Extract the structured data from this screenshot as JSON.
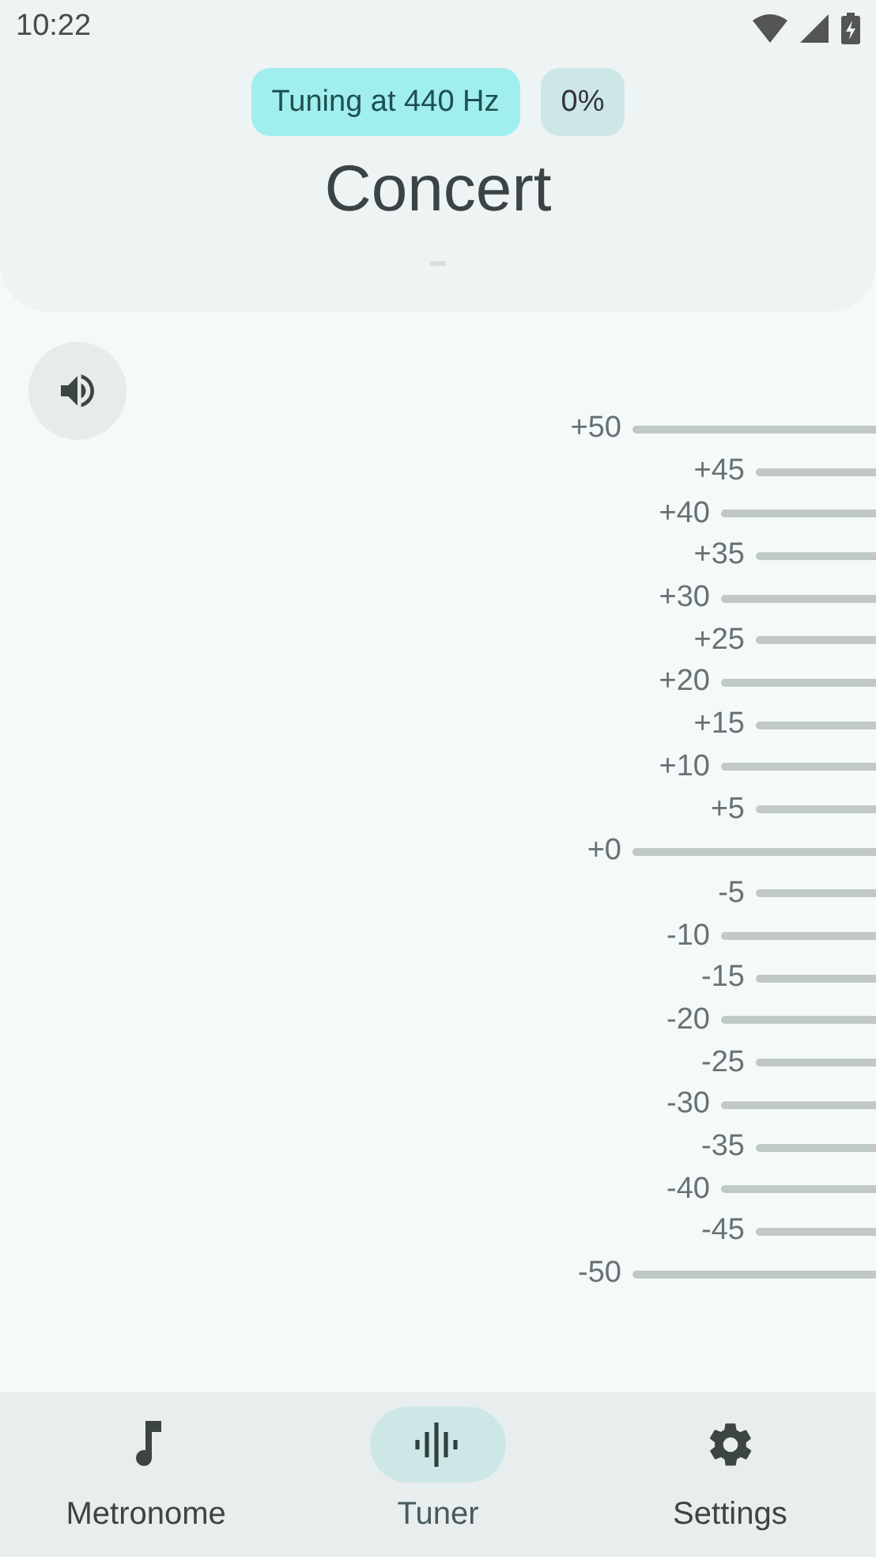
{
  "status_bar": {
    "time": "10:22"
  },
  "header": {
    "chips": [
      {
        "label": "Tuning at 440 Hz",
        "kind": "primary"
      },
      {
        "label": "0%",
        "kind": "secondary"
      }
    ],
    "title": "Concert"
  },
  "scale": {
    "ticks": [
      {
        "label": "+50",
        "kind": "major"
      },
      {
        "label": "+45",
        "kind": "minor"
      },
      {
        "label": "+40",
        "kind": "medium"
      },
      {
        "label": "+35",
        "kind": "minor"
      },
      {
        "label": "+30",
        "kind": "medium"
      },
      {
        "label": "+25",
        "kind": "minor"
      },
      {
        "label": "+20",
        "kind": "medium"
      },
      {
        "label": "+15",
        "kind": "minor"
      },
      {
        "label": "+10",
        "kind": "medium"
      },
      {
        "label": "+5",
        "kind": "minor"
      },
      {
        "label": "+0",
        "kind": "major"
      },
      {
        "label": "-5",
        "kind": "minor"
      },
      {
        "label": "-10",
        "kind": "medium"
      },
      {
        "label": "-15",
        "kind": "minor"
      },
      {
        "label": "-20",
        "kind": "medium"
      },
      {
        "label": "-25",
        "kind": "minor"
      },
      {
        "label": "-30",
        "kind": "medium"
      },
      {
        "label": "-35",
        "kind": "minor"
      },
      {
        "label": "-40",
        "kind": "medium"
      },
      {
        "label": "-45",
        "kind": "minor"
      },
      {
        "label": "-50",
        "kind": "major"
      }
    ]
  },
  "nav": [
    {
      "label": "Metronome",
      "selected": false
    },
    {
      "label": "Tuner",
      "selected": true
    },
    {
      "label": "Settings",
      "selected": false
    }
  ]
}
